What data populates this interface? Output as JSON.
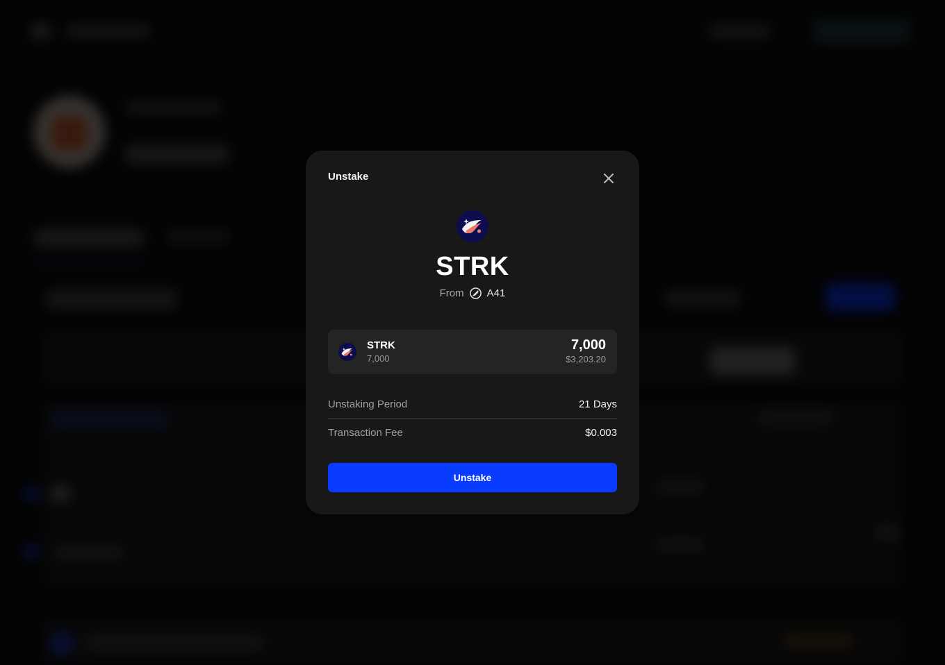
{
  "modal": {
    "title": "Unstake",
    "close_icon": "close-icon",
    "token_symbol": "STRK",
    "from_label": "From",
    "validator_name": "A41",
    "validator_icon": "validator-logo-icon",
    "token_icon": "starknet-logo-icon"
  },
  "token_card": {
    "name": "STRK",
    "sub_amount": "7,000",
    "amount": "7,000",
    "usd_value": "$3,203.20"
  },
  "details": [
    {
      "label": "Unstaking Period",
      "value": "21 Days"
    },
    {
      "label": "Transaction Fee",
      "value": "$0.003"
    }
  ],
  "action": {
    "label": "Unstake"
  },
  "colors": {
    "accent": "#0a3cff",
    "modal_bg": "#181818",
    "card_bg": "#242424"
  }
}
